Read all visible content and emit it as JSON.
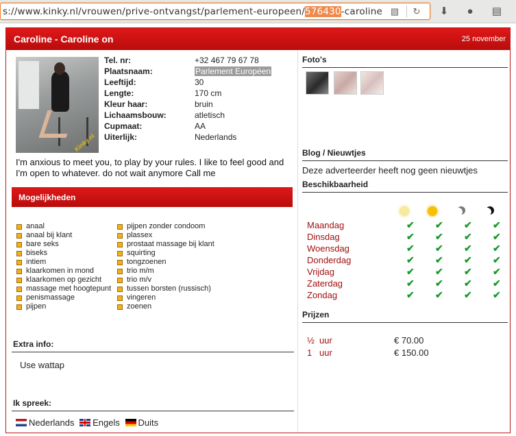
{
  "browser": {
    "url_prefix": "s://www.kinky.nl/vrouwen/prive-ontvangst/parlement-europeen/",
    "url_highlight": "576430",
    "url_suffix": "-caroline",
    "reader_icon": "reader-mode-icon",
    "reload_icon": "reload-icon",
    "toolbar_icons": [
      "download-icon",
      "extension-icon",
      "clipboard-icon"
    ]
  },
  "header": {
    "title": "Caroline - Caroline on",
    "date": "25 november"
  },
  "profile": {
    "fields": [
      {
        "label": "Tel. nr:",
        "value": "+32 467 79 67 78"
      },
      {
        "label": "Plaatsnaam:",
        "value": "Parlement Européen"
      },
      {
        "label": "Leeftijd:",
        "value": "30"
      },
      {
        "label": "Lengte:",
        "value": "170 cm"
      },
      {
        "label": "Kleur haar:",
        "value": "bruin"
      },
      {
        "label": "Lichaamsbouw:",
        "value": "atletisch"
      },
      {
        "label": "Cupmaat:",
        "value": "AA"
      },
      {
        "label": "Uiterlijk:",
        "value": "Nederlands"
      }
    ],
    "photo_watermark": "Kinky.nl",
    "description": "I'm anxious to meet you, to play by your rules. I like to feel good and I'm open to whatever. do not wait anymore Call me"
  },
  "mogelijkheden": {
    "title": "Mogelijkheden",
    "col1": [
      "anaal",
      "anaal bij klant",
      "bare seks",
      "biseks",
      "intiem",
      "klaarkomen in mond",
      "klaarkomen op gezicht",
      "massage met hoogtepunt",
      "penismassage",
      "pijpen"
    ],
    "col2": [
      "pijpen zonder condoom",
      "plassex",
      "prostaat massage bij klant",
      "squirting",
      "tongzoenen",
      "trio m/m",
      "trio m/v",
      "tussen borsten (russisch)",
      "vingeren",
      "zoenen"
    ]
  },
  "extra": {
    "title": "Extra info:",
    "text": "Use wattap"
  },
  "languages": {
    "title": "Ik spreek:",
    "items": [
      "Nederlands",
      "Engels",
      "Duits"
    ]
  },
  "fotos": {
    "title": "Foto's"
  },
  "blog": {
    "title": "Blog / Nieuwtjes",
    "text": "Deze adverteerder heeft nog geen nieuwtjes"
  },
  "beschikbaarheid": {
    "title": "Beschikbaarheid",
    "days": [
      "Maandag",
      "Dinsdag",
      "Woensdag",
      "Donderdag",
      "Vrijdag",
      "Zaterdag",
      "Zondag"
    ]
  },
  "prijzen": {
    "title": "Prijzen",
    "rows": [
      {
        "qty": "½",
        "unit": "uur",
        "price": "€ 70.00"
      },
      {
        "qty": "1",
        "unit": "uur",
        "price": "€ 150.00"
      }
    ]
  },
  "colors": {
    "brand_red": "#c81212",
    "day_red": "#a01010",
    "check_green": "#1a9a2a",
    "url_highlight": "#f08a4a"
  }
}
